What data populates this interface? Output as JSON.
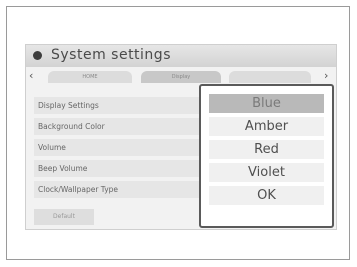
{
  "window": {
    "title": "System settings"
  },
  "tabs": [
    {
      "label": "HOME"
    },
    {
      "label": "Display"
    },
    {
      "label": ""
    }
  ],
  "menu": {
    "items": [
      {
        "label": "Display Settings"
      },
      {
        "label": "Background Color"
      },
      {
        "label": "Volume"
      },
      {
        "label": "Beep Volume"
      },
      {
        "label": "Clock/Wallpaper Type"
      }
    ]
  },
  "footer": {
    "left_button_label": "Default"
  },
  "popup": {
    "options": [
      {
        "label": "Blue",
        "selected": true
      },
      {
        "label": "Amber",
        "selected": false
      },
      {
        "label": "Red",
        "selected": false
      },
      {
        "label": "Violet",
        "selected": false
      },
      {
        "label": "OK",
        "selected": false
      }
    ]
  },
  "icons": {
    "title_icon": "settings-dot-icon",
    "back": "chevron-left-icon",
    "next": "chevron-right-icon"
  },
  "colors": {
    "titlebar": "#d9d9d9",
    "popup_border": "#5a5a5a",
    "selected_option": "#b9b9b9"
  }
}
